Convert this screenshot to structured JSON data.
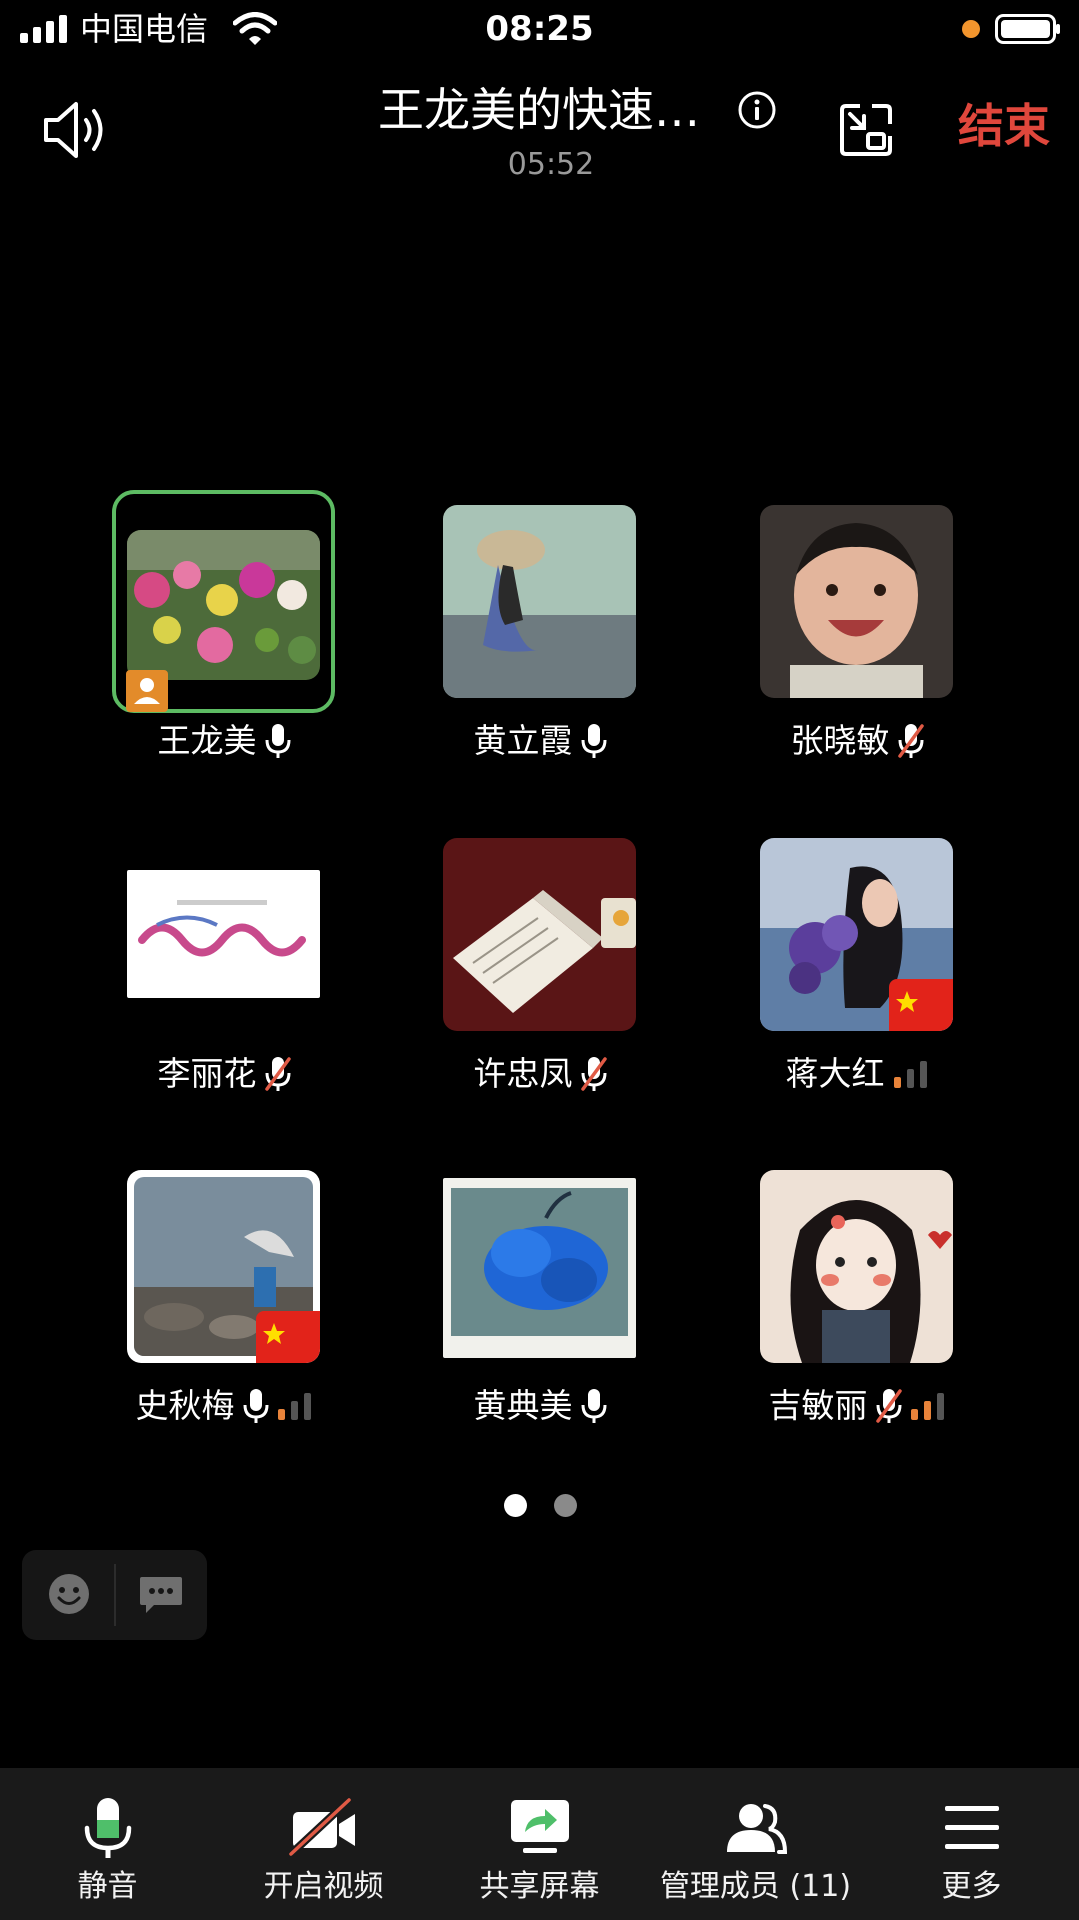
{
  "status_bar": {
    "carrier": "中国电信",
    "time": "08:25"
  },
  "header": {
    "title": "王龙美的快速…",
    "duration": "05:52",
    "end_label": "结束"
  },
  "participants": [
    {
      "name": "王龙美",
      "mic": "on",
      "speaking": true,
      "host": true
    },
    {
      "name": "黄立霞",
      "mic": "on"
    },
    {
      "name": "张晓敏",
      "mic": "muted"
    },
    {
      "name": "李丽花",
      "mic": "muted"
    },
    {
      "name": "许忠凤",
      "mic": "muted"
    },
    {
      "name": "蒋大红",
      "mic": "none",
      "signal_bars": 1
    },
    {
      "name": "史秋梅",
      "mic": "on",
      "signal_bars": 1
    },
    {
      "name": "黄典美",
      "mic": "on"
    },
    {
      "name": "吉敏丽",
      "mic": "muted",
      "signal_bars": 2
    }
  ],
  "pager": {
    "pages": 2,
    "current": 1
  },
  "toolbar": {
    "mute_label": "静音",
    "video_label": "开启视频",
    "share_label": "共享屏幕",
    "members_label": "管理成员 (11)",
    "more_label": "更多"
  },
  "colors": {
    "background": "#000000",
    "toolbar_bg": "#1a1a1a",
    "end_red": "#e0473c",
    "speaking_green": "#5dbb63",
    "muted_red": "#e05a45",
    "signal_orange": "#e8833a"
  }
}
